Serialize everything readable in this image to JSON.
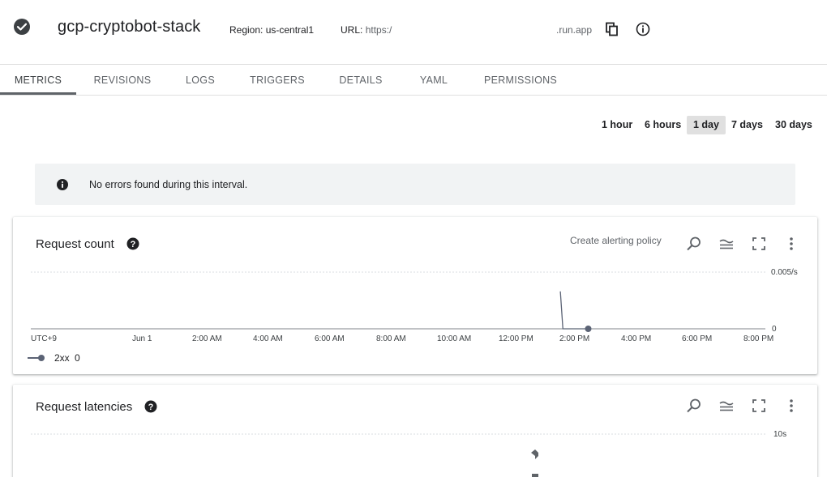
{
  "header": {
    "service_name": "gcp-cryptobot-stack",
    "region": "Region: us-central1",
    "url_label": "URL:",
    "url_value": "https:/",
    "url_suffix": ".run.app",
    "icons": [
      "check-circle-icon",
      "copy-icon",
      "info-icon"
    ]
  },
  "tabs": [
    {
      "label": "METRICS",
      "active": true
    },
    {
      "label": "REVISIONS",
      "active": false
    },
    {
      "label": "LOGS",
      "active": false
    },
    {
      "label": "TRIGGERS",
      "active": false
    },
    {
      "label": "DETAILS",
      "active": false
    },
    {
      "label": "YAML",
      "active": false
    },
    {
      "label": "PERMISSIONS",
      "active": false
    }
  ],
  "time_ranges": [
    {
      "label": "1 hour",
      "selected": false
    },
    {
      "label": "6 hours",
      "selected": false
    },
    {
      "label": "1 day",
      "selected": true
    },
    {
      "label": "7 days",
      "selected": false
    },
    {
      "label": "30 days",
      "selected": false
    }
  ],
  "banner": {
    "text": "No errors found during this interval.",
    "icon": "info-icon"
  },
  "request_count": {
    "title": "Request count",
    "alert_link": "Create alerting policy",
    "legend": {
      "name": "2xx",
      "value": "0"
    },
    "colors": {
      "series": "#5b6375"
    }
  },
  "request_latencies": {
    "title": "Request latencies"
  },
  "chart_data": [
    {
      "type": "line",
      "title": "Request count",
      "x_tick_labels": [
        "UTC+9",
        "Jun 1",
        "2:00 AM",
        "4:00 AM",
        "6:00 AM",
        "8:00 AM",
        "10:00 AM",
        "12:00 PM",
        "2:00 PM",
        "4:00 PM",
        "6:00 PM",
        "8:00 PM"
      ],
      "y_tick_labels": [
        "0.005/s",
        "0"
      ],
      "ylim": [
        0,
        0.005
      ],
      "series": [
        {
          "name": "2xx",
          "x": [
            "1:25 PM",
            "1:30 PM",
            "2:20 PM"
          ],
          "y": [
            0.0033,
            0,
            0
          ]
        }
      ],
      "grid": true,
      "legend_position": "bottom-left"
    },
    {
      "type": "line",
      "title": "Request latencies",
      "y_tick_labels": [
        "10s"
      ],
      "grid": true
    }
  ]
}
